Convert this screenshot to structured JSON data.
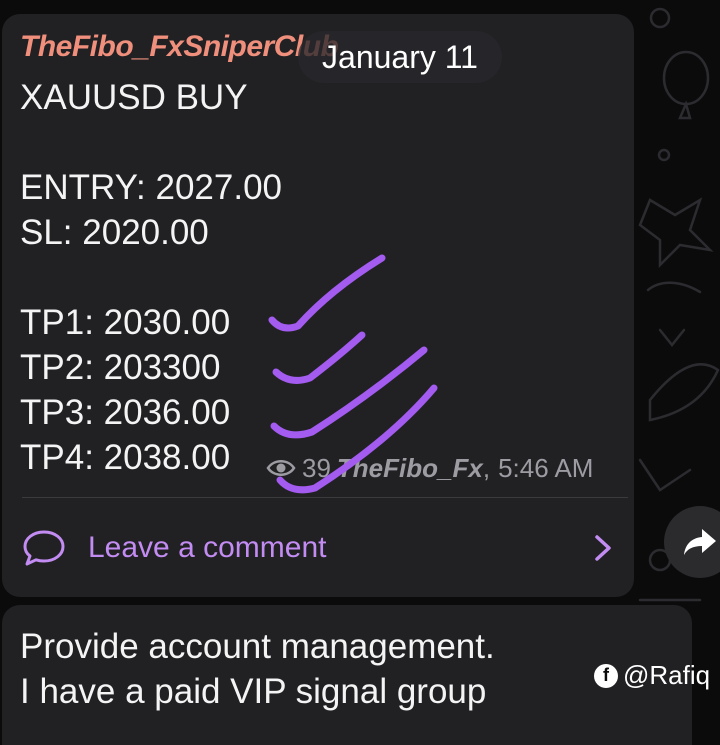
{
  "message": {
    "channel_name": "TheFibo_FxSniperClub",
    "date_label": "January 11",
    "lines": {
      "pair": "XAUUSD BUY",
      "entry": "ENTRY: 2027.00",
      "sl": "SL: 2020.00",
      "tp1": "TP1: 2030.00",
      "tp2": "TP2: 203300",
      "tp3": "TP3: 2036.00",
      "tp4": "TP4: 2038.00"
    },
    "views": "39",
    "author": "TheFibo_Fx",
    "separator": ",",
    "time": "5:46 AM",
    "comment_label": "Leave a comment"
  },
  "next_message": {
    "line1": "Provide account management.",
    "line2": "I have a paid VIP signal group"
  },
  "watermark": {
    "text": "@Rafiq",
    "icon": "facebook-icon"
  },
  "icons": {
    "views": "eye-icon",
    "comment": "comment-bubble-icon",
    "chevron": "chevron-right-icon",
    "share": "share-arrow-icon",
    "tick": "checkmark-icon"
  },
  "colors": {
    "background": "#0b0b0c",
    "bubble": "#212124",
    "channel_name": "#ef8f7c",
    "accent": "#c38cf2",
    "check_marks": "#a35bf0",
    "meta_text": "#9c9ca2"
  }
}
